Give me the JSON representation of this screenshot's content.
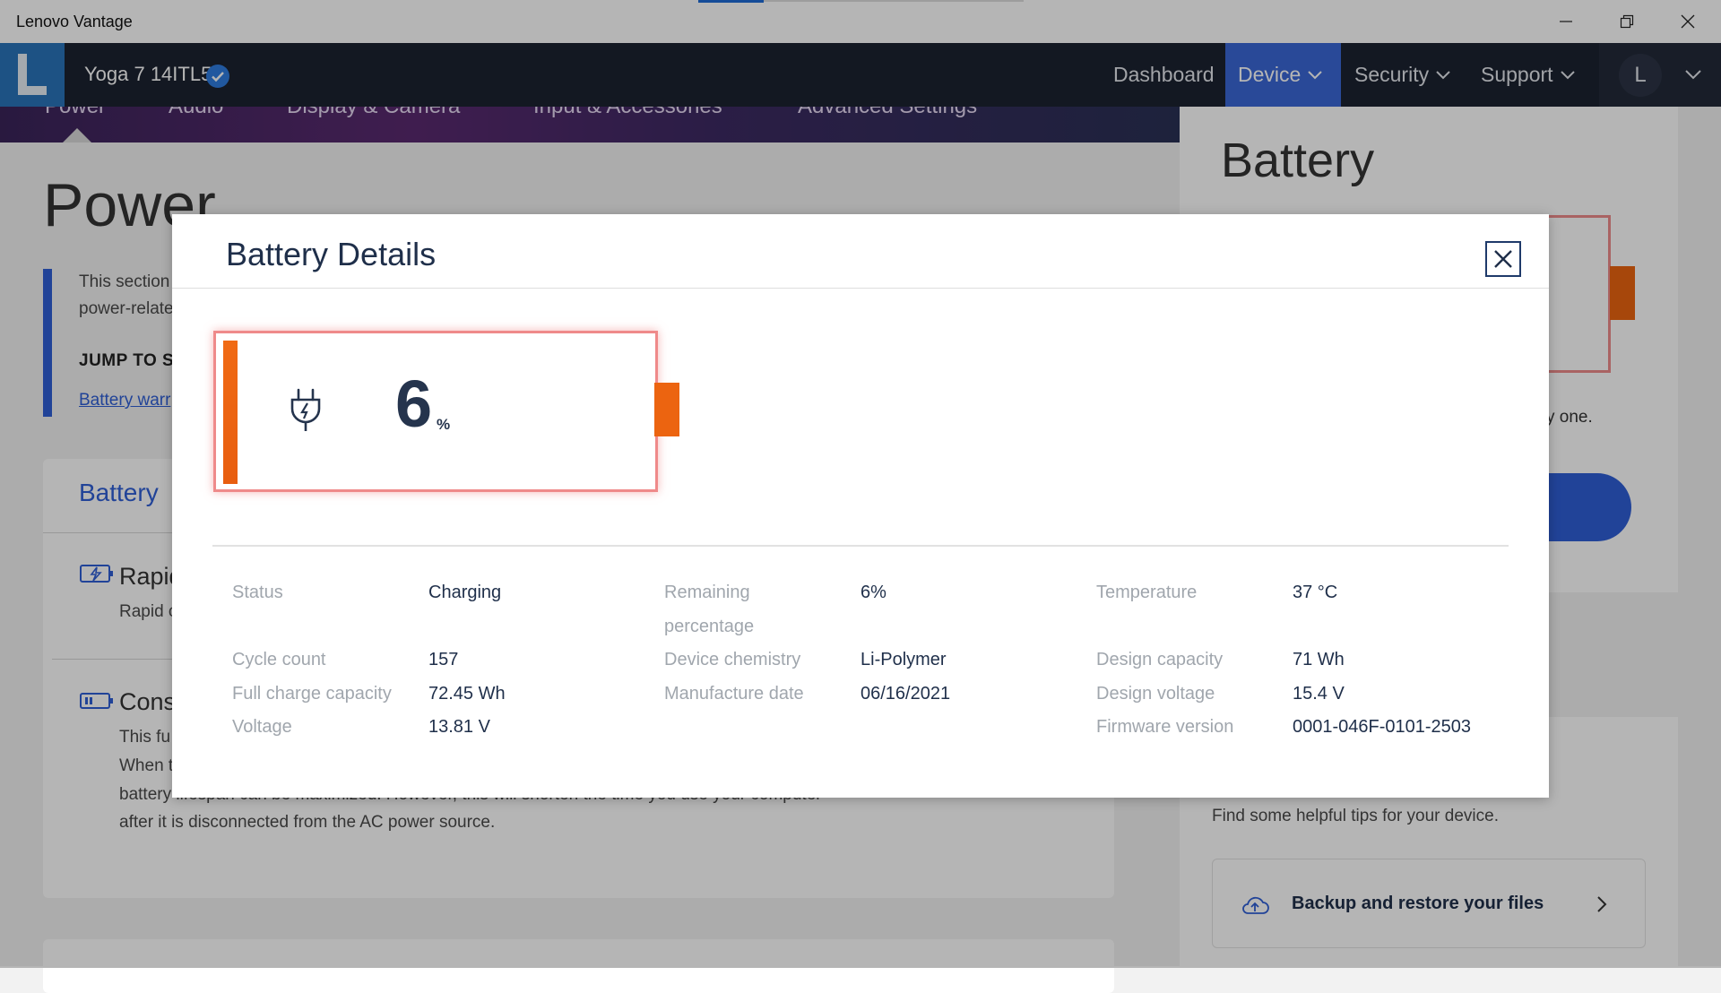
{
  "window": {
    "title": "Lenovo Vantage"
  },
  "header": {
    "device_name": "Yoga 7 14ITL5",
    "nav": [
      {
        "label": "Dashboard"
      },
      {
        "label": "Device"
      },
      {
        "label": "Security"
      },
      {
        "label": "Support"
      }
    ],
    "user_initial": "L"
  },
  "hero": {
    "subnav": [
      "Power",
      "Audio",
      "Display & Camera",
      "Input & Accessories",
      "Advanced Settings"
    ]
  },
  "background_page": {
    "title": "Power",
    "intro_line1": "This section",
    "intro_line2": "power-relate",
    "jump_to": "JUMP TO S",
    "jump_link": "Battery warr",
    "battery_card_title": "Battery",
    "rapid_title": "Rapid",
    "rapid_desc": "Rapid c",
    "cons_title": "Cons",
    "cons_line1": "This fu",
    "cons_line2": "When t",
    "cons_line3": "battery lifespan can be maximized. However, this will shorten the time you use your computer",
    "cons_line4": "after it is disconnected from the AC power source.",
    "right_title": "Battery",
    "right_text": "y one.",
    "tips_text": "Find some helpful tips for your device.",
    "tip_item": "Backup and restore your files"
  },
  "modal": {
    "title": "Battery Details",
    "battery_percent": "6",
    "percent_sign": "%",
    "charge_level_fraction": 0.06,
    "colors": {
      "charge": "#ec6410",
      "border": "#ef8a8a",
      "accent": "#3a68d6"
    },
    "details": {
      "col1": [
        {
          "label": "Status",
          "value": "Charging"
        },
        {
          "label": "Cycle count",
          "value": "157"
        },
        {
          "label": "Full charge capacity",
          "value": "72.45 Wh"
        },
        {
          "label": "Voltage",
          "value": "13.81 V"
        }
      ],
      "col2": [
        {
          "label_line1": "Remaining",
          "label_line2": "percentage",
          "value": "6%"
        },
        {
          "label": "Device chemistry",
          "value": "Li-Polymer"
        },
        {
          "label": "Manufacture date",
          "value": "06/16/2021"
        }
      ],
      "col3": [
        {
          "label": "Temperature",
          "value": "37 °C"
        },
        {
          "label": "Design capacity",
          "value": "71 Wh"
        },
        {
          "label": "Design voltage",
          "value": "15.4 V"
        },
        {
          "label": "Firmware version",
          "value": "0001-046F-0101-2503"
        }
      ]
    }
  },
  "icons": [
    "minimize-icon",
    "restore-icon",
    "close-icon",
    "verified-icon",
    "chevron-down-icon",
    "plug-icon",
    "cloud-icon",
    "chevron-right-icon"
  ]
}
